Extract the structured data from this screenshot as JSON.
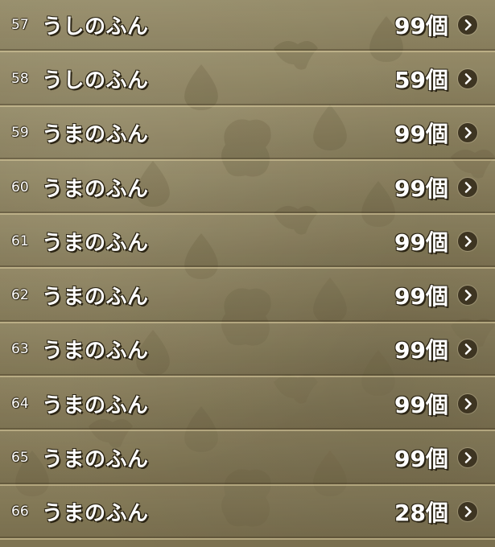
{
  "item_list": {
    "rows": [
      {
        "number": "57",
        "name": "うしのふん",
        "quantity": "99個"
      },
      {
        "number": "58",
        "name": "うしのふん",
        "quantity": "59個"
      },
      {
        "number": "59",
        "name": "うまのふん",
        "quantity": "99個"
      },
      {
        "number": "60",
        "name": "うまのふん",
        "quantity": "99個"
      },
      {
        "number": "61",
        "name": "うまのふん",
        "quantity": "99個"
      },
      {
        "number": "62",
        "name": "うまのふん",
        "quantity": "99個"
      },
      {
        "number": "63",
        "name": "うまのふん",
        "quantity": "99個"
      },
      {
        "number": "64",
        "name": "うまのふん",
        "quantity": "99個"
      },
      {
        "number": "65",
        "name": "うまのふん",
        "quantity": "99個"
      },
      {
        "number": "66",
        "name": "うまのふん",
        "quantity": "28個"
      }
    ],
    "row_icon": "chevron-right-icon"
  },
  "colors": {
    "background": "#857a57",
    "divider": "#dccda0",
    "text": "#ffffff",
    "text_outline": "#2b2414",
    "chevron_bg": "#3e3522"
  }
}
